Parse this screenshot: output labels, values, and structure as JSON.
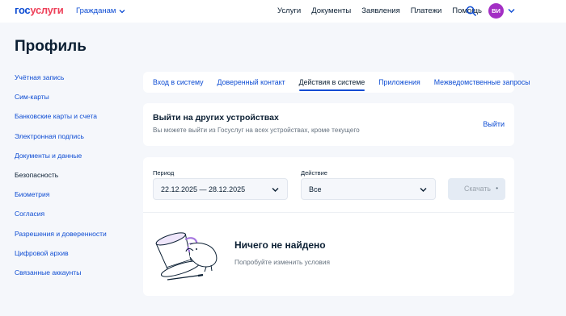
{
  "header": {
    "logo_part1": "гос",
    "logo_part2": "услуги",
    "audience": "Гражданам",
    "nav": [
      "Услуги",
      "Документы",
      "Заявления",
      "Платежи",
      "Помощь"
    ],
    "avatar_initials": "ВИ"
  },
  "page_title": "Профиль",
  "sidebar": {
    "items": [
      {
        "label": "Учётная запись"
      },
      {
        "label": "Сим-карты"
      },
      {
        "label": "Банковские карты и счета"
      },
      {
        "label": "Электронная подпись"
      },
      {
        "label": "Документы и данные"
      },
      {
        "label": "Безопасность",
        "active": true
      },
      {
        "label": "Биометрия"
      },
      {
        "label": "Согласия"
      },
      {
        "label": "Разрешения и доверенности"
      },
      {
        "label": "Цифровой архив"
      },
      {
        "label": "Связанные аккаунты"
      }
    ]
  },
  "tabs": [
    {
      "label": "Вход в систему"
    },
    {
      "label": "Доверенный контакт"
    },
    {
      "label": "Действия в системе",
      "active": true
    },
    {
      "label": "Приложения"
    },
    {
      "label": "Межведомственные запросы"
    }
  ],
  "devices": {
    "title": "Выйти на других устройствах",
    "description": "Вы можете выйти из Госуслуг на всех устройствах, кроме текущего",
    "action": "Выйти"
  },
  "filter": {
    "period_label": "Период",
    "period_value": "22.12.2025 — 28.12.2025",
    "action_label": "Действие",
    "action_value": "Все",
    "download_label": "Скачать"
  },
  "empty": {
    "title": "Ничего не найдено",
    "subtitle": "Попробуйте изменить условия"
  },
  "colors": {
    "brand_blue": "#0d4cd3",
    "brand_red": "#ee3f58",
    "avatar": "#a32fc4",
    "background": "#f5f7fb"
  }
}
